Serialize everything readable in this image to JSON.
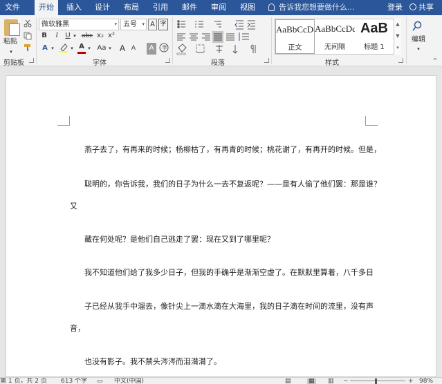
{
  "tabs": [
    "文件",
    "开始",
    "插入",
    "设计",
    "布局",
    "引用",
    "邮件",
    "审阅",
    "视图"
  ],
  "active_tab": "开始",
  "tell_me": "告诉我您想要做什么...",
  "login": "登录",
  "share": "共享",
  "clipboard": {
    "paste": "粘贴",
    "group": "剪贴板"
  },
  "font": {
    "name": "微软雅黑",
    "size": "五号",
    "bold": "B",
    "italic": "I",
    "underline": "U",
    "strike": "abc",
    "sub": "x₂",
    "sup": "x²",
    "font_color": "A",
    "change_case": "Aa",
    "grow": "A",
    "shrink": "A",
    "char_border": "A",
    "enclose": "字",
    "group": "字体"
  },
  "paragraph": {
    "group": "段落"
  },
  "styles": {
    "group": "样式",
    "items": [
      {
        "sample": "AaBbCcDc",
        "name": "正文"
      },
      {
        "sample": "AaBbCcDc",
        "name": "无间隔"
      },
      {
        "sample": "AaB",
        "name": "标题 1"
      }
    ]
  },
  "editing": {
    "label": "编辑"
  },
  "document": {
    "paragraphs": [
      "燕子去了，有再来的时候；杨柳枯了，有再青的时候；桃花谢了，有再开的时候。但是，",
      "聪明的，你告诉我，我们的日子为什么一去不复返呢？——是有人偷了他们罢：那是谁？",
      "又",
      "藏在何处呢？是他们自己逃走了罢：现在又到了哪里呢？",
      "我不知道他们给了我多少日子，但我的手确乎是渐渐空虚了。在默默里算着，八千多日",
      "子已经从我手中溜去，像针尖上一滴水滴在大海里，我的日子滴在时间的流里，没有声",
      "音，",
      "也没有影子。我不禁头涔涔而泪潸潸了。"
    ]
  },
  "status": {
    "page": "第 1 页，共 2 页",
    "words": "613 个字",
    "language": "中文(中国)",
    "zoom": "98%"
  },
  "colors": {
    "accent": "#2b579a",
    "font_color_bar": "#c00000",
    "highlight_bar": "#ffff00"
  }
}
